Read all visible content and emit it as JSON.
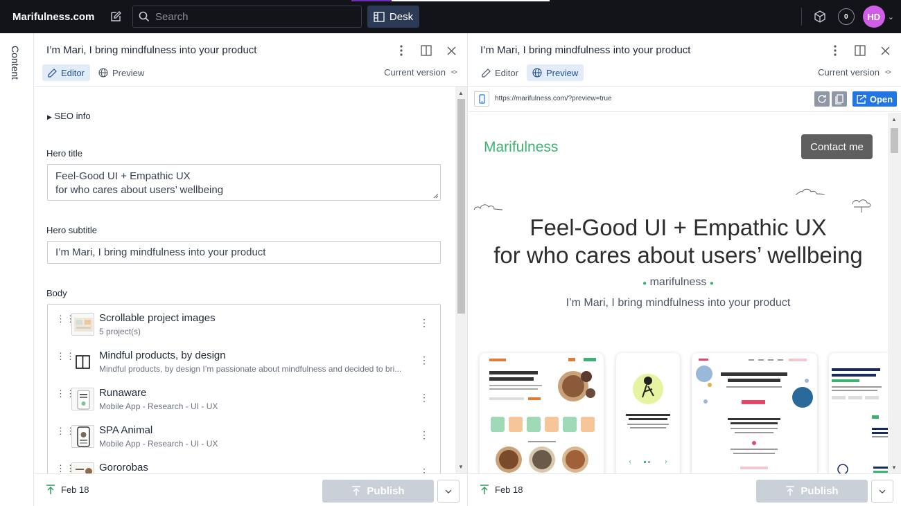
{
  "app": {
    "brand": "Marifulness.com",
    "search_placeholder": "Search",
    "desk_label": "Desk",
    "notification_count": "0",
    "avatar_initials": "HD",
    "accent": "#2276e3",
    "avatar_color": "#d25ee8"
  },
  "rail": {
    "label": "Content"
  },
  "editor_pane": {
    "title": "I’m Mari, I bring mindfulness into your product",
    "tab_editor": "Editor",
    "tab_preview": "Preview",
    "version": "Current version",
    "seo_label": "SEO info",
    "hero_title_label": "Hero title",
    "hero_title_line1": "Feel-Good UI + Empathic UX",
    "hero_title_line2": "for who cares about users’ wellbeing",
    "hero_subtitle_label": "Hero subtitle",
    "hero_subtitle_value": "I’m Mari, I bring mindfulness into your product",
    "body_label": "Body",
    "body_items": [
      {
        "title": "Scrollable project images",
        "subtitle": "5 project(s)"
      },
      {
        "title": "Mindful products, by design",
        "subtitle": "Mindful products, by design I’m passionate about mindfulness and decided to bri..."
      },
      {
        "title": "Runaware",
        "subtitle": "Mobile App - Research - UI - UX"
      },
      {
        "title": "SPA Animal",
        "subtitle": "Mobile App - Research - UI - UX"
      },
      {
        "title": "Gororobas",
        "subtitle": ""
      }
    ],
    "footer_date": "Feb 18",
    "publish_label": "Publish"
  },
  "preview_pane": {
    "title": "I’m Mari, I bring mindfulness into your product",
    "tab_editor": "Editor",
    "tab_preview": "Preview",
    "version": "Current version",
    "url": "https://marifulness.com/?preview=true",
    "open_label": "Open",
    "site_logo": "Marifulness",
    "contact_label": "Contact me",
    "hero_line1": "Feel-Good UI + Empathic UX",
    "hero_line2": "for who cares about users’ wellbeing",
    "brand_tag": "marifulness",
    "subtitle": "I’m Mari, I bring mindfulness into your product",
    "footer_date": "Feb 18",
    "publish_label": "Publish"
  }
}
